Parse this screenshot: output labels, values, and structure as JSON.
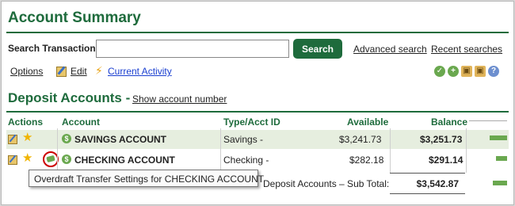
{
  "page": {
    "title": "Account Summary"
  },
  "search": {
    "label": "Search Transactions:",
    "value": "",
    "placeholder": "",
    "button_label": "Search",
    "advanced_link": "Advanced search",
    "recent_link": "Recent searches"
  },
  "options_bar": {
    "options": "Options",
    "edit": "Edit",
    "current_activity": "Current Activity",
    "tool_icons": [
      "check-icon",
      "add-icon",
      "box-icon",
      "box-icon",
      "help-icon"
    ]
  },
  "deposit": {
    "title": "Deposit Accounts -",
    "show_number_link": "Show account number",
    "columns": {
      "actions": "Actions",
      "account": "Account",
      "type": "Type/Acct ID",
      "available": "Available",
      "balance": "Balance"
    },
    "rows": [
      {
        "name": "SAVINGS ACCOUNT",
        "type": "Savings - ",
        "available": "$3,241.73",
        "balance": "$3,251.73",
        "bar_fraction": 0.45
      },
      {
        "name": "CHECKING ACCOUNT",
        "type": "Checking - ",
        "available": "$282.18",
        "balance": "$291.14",
        "bar_fraction": 0.3
      }
    ],
    "subtotal_label": "Deposit Accounts – Sub Total:",
    "subtotal_value": "$3,542.87",
    "subtotal_bar_fraction": 0.35
  },
  "tooltip": "Overdraft Transfer Settings for CHECKING ACCOUNT",
  "colors": {
    "brand_green": "#1e6b3c",
    "row_shade": "#e6eedf",
    "accent_red": "#cc0000"
  }
}
